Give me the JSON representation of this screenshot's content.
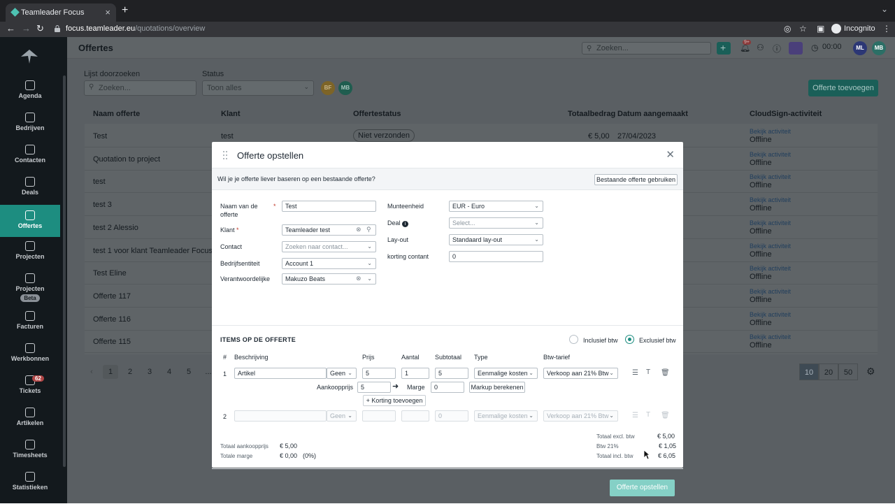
{
  "browser": {
    "tab_title": "Teamleader Focus",
    "url_host": "focus.teamleader.eu",
    "url_path": "/quotations/overview",
    "incognito_label": "Incognito"
  },
  "sidebar": {
    "items": [
      {
        "label": "Agenda",
        "icon": "calendar-icon"
      },
      {
        "label": "Bedrijven",
        "icon": "building-icon"
      },
      {
        "label": "Contacten",
        "icon": "contact-icon"
      },
      {
        "label": "Deals",
        "icon": "target-icon"
      },
      {
        "label": "Offertes",
        "icon": "document-icon"
      },
      {
        "label": "Projecten",
        "icon": "project-icon"
      },
      {
        "label": "Projecten",
        "icon": "project-icon",
        "badge": "Beta"
      },
      {
        "label": "Facturen",
        "icon": "invoice-icon"
      },
      {
        "label": "Werkbonnen",
        "icon": "workorder-icon"
      },
      {
        "label": "Tickets",
        "icon": "ticket-icon",
        "count": "62"
      },
      {
        "label": "Artikelen",
        "icon": "box-icon"
      },
      {
        "label": "Timesheets",
        "icon": "clock-icon"
      },
      {
        "label": "Statistieken",
        "icon": "chart-icon"
      }
    ]
  },
  "topbar": {
    "title": "Offertes",
    "search_placeholder": "Zoeken...",
    "notif_count": "9+",
    "timer": "00:00",
    "avatar_initials": "MB"
  },
  "filters": {
    "search_label": "Lijst doorzoeken",
    "search_placeholder": "Zoeken...",
    "status_label": "Status",
    "status_value": "Toon alles",
    "avatar1": "BF",
    "avatar2": "MB",
    "add_button": "Offerte toevoegen"
  },
  "table": {
    "headers": [
      "Naam offerte",
      "Klant",
      "Offertestatus",
      "Totaalbedrag",
      "Datum aangemaakt",
      "CloudSign-activiteit"
    ],
    "rows": [
      {
        "name": "Test",
        "client": "test",
        "status": "Niet verzonden",
        "amount": "€ 5,00",
        "date": "27/04/2023",
        "link": "Bekijk activiteit",
        "activity": "Offline"
      },
      {
        "name": "Quotation to project",
        "client": "",
        "status": "",
        "amount": "",
        "date": "",
        "link": "Bekijk activiteit",
        "activity": "Offline"
      },
      {
        "name": "test",
        "client": "",
        "status": "",
        "amount": "",
        "date": "",
        "link": "Bekijk activiteit",
        "activity": "Offline"
      },
      {
        "name": "test 3",
        "client": "",
        "status": "",
        "amount": "",
        "date": "",
        "link": "Bekijk activiteit",
        "activity": "Offline"
      },
      {
        "name": "test 2 Alessio",
        "client": "",
        "status": "",
        "amount": "",
        "date": "",
        "link": "Bekijk activiteit",
        "activity": "Offline"
      },
      {
        "name": "test 1 voor klant Teamleader Focus",
        "client": "",
        "status": "",
        "amount": "",
        "date": "",
        "link": "Bekijk activiteit",
        "activity": "Offline"
      },
      {
        "name": "Test Eline",
        "client": "",
        "status": "",
        "amount": "",
        "date": "",
        "link": "Bekijk activiteit",
        "activity": "Offline"
      },
      {
        "name": "Offerte 117",
        "client": "",
        "status": "",
        "amount": "",
        "date": "",
        "link": "Bekijk activiteit",
        "activity": "Offline"
      },
      {
        "name": "Offerte 116",
        "client": "",
        "status": "",
        "amount": "",
        "date": "",
        "link": "Bekijk activiteit",
        "activity": "Offline"
      },
      {
        "name": "Offerte 115",
        "client": "",
        "status": "",
        "amount": "",
        "date": "",
        "link": "Bekijk activiteit",
        "activity": "Offline"
      }
    ]
  },
  "pagination": {
    "pages": [
      "1",
      "2",
      "3",
      "4",
      "5",
      "..."
    ],
    "per_page": [
      "10",
      "20",
      "50"
    ]
  },
  "modal": {
    "title": "Offerte opstellen",
    "base_question": "Wil je je offerte liever baseren op een bestaande offerte?",
    "base_button": "Bestaande offerte gebruiken",
    "fields": {
      "name_label": "Naam van de offerte",
      "name_value": "Test",
      "client_label": "Klant",
      "client_value": "Teamleader test",
      "contact_label": "Contact",
      "contact_placeholder": "Zoeken naar contact...",
      "entity_label": "Bedrijfsentiteit",
      "entity_value": "Account 1",
      "owner_label": "Verantwoordelijke",
      "owner_value": "Makuzo Beats",
      "currency_label": "Munteenheid",
      "currency_value": "EUR - Euro",
      "deal_label": "Deal",
      "deal_placeholder": "Select...",
      "layout_label": "Lay-out",
      "layout_value": "Standaard lay-out",
      "discount_label": "korting contant",
      "discount_value": "0"
    },
    "items_title": "ITEMS OP DE OFFERTE",
    "incl_label": "Inclusief btw",
    "excl_label": "Exclusief btw",
    "columns": [
      "#",
      "Beschrijving",
      "Prijs",
      "Aantal",
      "Subtotaal",
      "Type",
      "Btw-tarief"
    ],
    "line1": {
      "num": "1",
      "description": "Artikel",
      "unit": "Geen",
      "price": "5",
      "qty": "1",
      "subtotal": "5",
      "type": "Eenmalige kosten",
      "vat": "Verkoop aan 21% Btw",
      "purchase_label": "Aankoopprijs",
      "purchase_value": "5",
      "margin_label": "Marge",
      "margin_value": "0",
      "markup_button": "Markup berekenen",
      "discount_button": "+ Korting toevoegen"
    },
    "line2": {
      "num": "2",
      "unit": "Geen",
      "subtotal": "0",
      "type": "Eenmalige kosten",
      "vat": "Verkoop aan 21% Btw"
    },
    "totals_left": {
      "purchase_label": "Totaal aankoopprijs",
      "purchase_value": "€ 5,00",
      "margin_label": "Totale marge",
      "margin_value": "€ 0,00",
      "margin_pct": "(0%)"
    },
    "totals_right": {
      "excl_label": "Totaal excl. btw",
      "excl_value": "€ 5,00",
      "vat_label": "Btw 21%",
      "vat_value": "€ 1,05",
      "incl_label": "Totaal incl. btw",
      "incl_value": "€ 6,05"
    },
    "submit": "Offerte opstellen"
  }
}
